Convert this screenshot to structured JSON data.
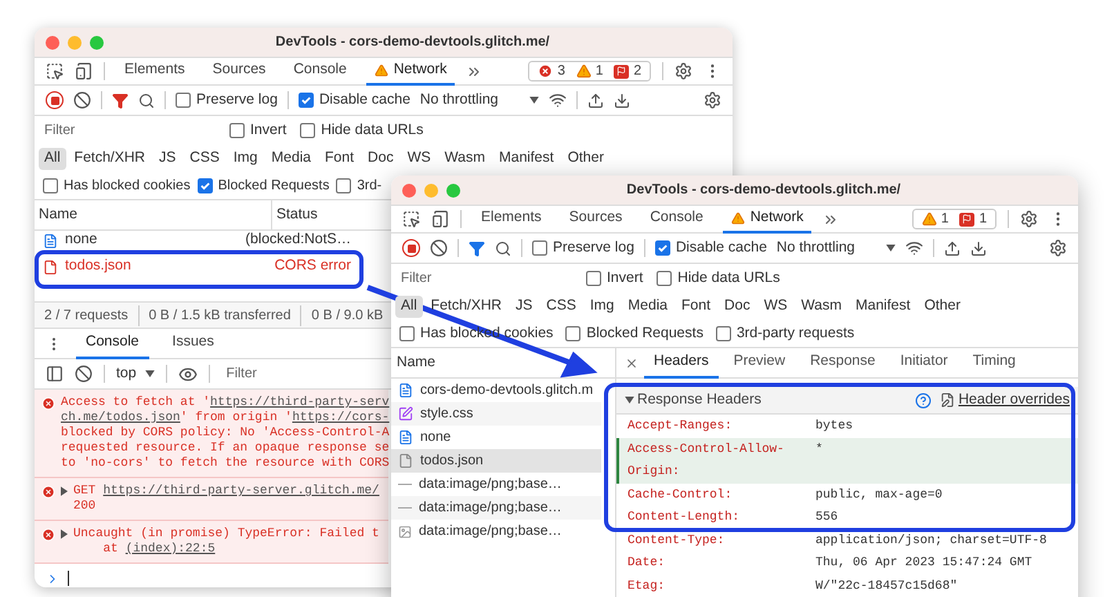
{
  "back_window": {
    "title": "DevTools - cors-demo-devtools.glitch.me/",
    "tabs": [
      {
        "label": "Elements",
        "selected": false,
        "warning": false
      },
      {
        "label": "Sources",
        "selected": false,
        "warning": false
      },
      {
        "label": "Console",
        "selected": false,
        "warning": false
      },
      {
        "label": "Network",
        "selected": true,
        "warning": true
      }
    ],
    "badges": [
      {
        "kind": "error",
        "count": "3"
      },
      {
        "kind": "warning",
        "count": "1"
      },
      {
        "kind": "issue",
        "count": "2"
      }
    ],
    "preserve_log": {
      "label": "Preserve log",
      "checked": false
    },
    "disable_cache": {
      "label": "Disable cache",
      "checked": true
    },
    "throttling": "No throttling",
    "filter": {
      "placeholder": "Filter"
    },
    "invert": {
      "label": "Invert",
      "checked": false
    },
    "hide_data_urls": {
      "label": "Hide data URLs",
      "checked": false
    },
    "type_filters": [
      {
        "label": "All",
        "selected": true
      },
      {
        "label": "Fetch/XHR",
        "selected": false
      },
      {
        "label": "JS",
        "selected": false
      },
      {
        "label": "CSS",
        "selected": false
      },
      {
        "label": "Img",
        "selected": false
      },
      {
        "label": "Media",
        "selected": false
      },
      {
        "label": "Font",
        "selected": false
      },
      {
        "label": "Doc",
        "selected": false
      },
      {
        "label": "WS",
        "selected": false
      },
      {
        "label": "Wasm",
        "selected": false
      },
      {
        "label": "Manifest",
        "selected": false
      },
      {
        "label": "Other",
        "selected": false
      }
    ],
    "extra_filters": [
      {
        "label": "Has blocked cookies",
        "checked": false
      },
      {
        "label": "Blocked Requests",
        "checked": true
      },
      {
        "label": "3rd-",
        "checked": false
      }
    ],
    "table": {
      "columns": [
        "Name",
        "Status"
      ],
      "rows": [
        {
          "name": "none",
          "status": "(blocked:NotS…",
          "error": false
        },
        {
          "name": "todos.json",
          "status": "CORS error",
          "error": true
        }
      ]
    },
    "status_bar": [
      "2 / 7 requests",
      "0 B / 1.5 kB transferred",
      "0 B / 9.0 kB"
    ],
    "drawer": {
      "tabs": [
        {
          "label": "Console",
          "selected": true
        },
        {
          "label": "Issues",
          "selected": false
        }
      ],
      "context": "top",
      "filter": {
        "placeholder": "Filter"
      },
      "messages": [
        {
          "kind": "error",
          "expandable": false,
          "lines": [
            [
              {
                "text": "Access to fetch at '",
                "link": false
              },
              {
                "text": "https://third-party-serv",
                "link": true
              }
            ],
            [
              {
                "text": "ch.me/todos.json",
                "link": true
              },
              {
                "text": "' from origin '",
                "link": false
              },
              {
                "text": "https://cors-",
                "link": true
              }
            ],
            [
              {
                "text": "blocked by CORS policy: No 'Access-Control-A",
                "link": false
              }
            ],
            [
              {
                "text": "requested resource. If an opaque response se",
                "link": false
              }
            ],
            [
              {
                "text": "to 'no-cors' to fetch the resource with CORS",
                "link": false
              }
            ]
          ]
        },
        {
          "kind": "error",
          "expandable": true,
          "lines": [
            [
              {
                "text": "GET ",
                "link": false
              },
              {
                "text": "https://third-party-server.glitch.me/",
                "link": true
              }
            ],
            [
              {
                "text": "200",
                "link": false
              }
            ]
          ]
        },
        {
          "kind": "error",
          "expandable": true,
          "lines": [
            [
              {
                "text": "Uncaught (in promise) TypeError: Failed t",
                "link": false
              }
            ],
            [
              {
                "text": "    at ",
                "link": false
              },
              {
                "text": "(index):22:5",
                "link": true
              }
            ]
          ]
        }
      ]
    }
  },
  "front_window": {
    "title": "DevTools - cors-demo-devtools.glitch.me/",
    "tabs": [
      {
        "label": "Elements",
        "selected": false,
        "warning": false
      },
      {
        "label": "Sources",
        "selected": false,
        "warning": false
      },
      {
        "label": "Console",
        "selected": false,
        "warning": false
      },
      {
        "label": "Network",
        "selected": true,
        "warning": true
      }
    ],
    "badges": [
      {
        "kind": "warning",
        "count": "1"
      },
      {
        "kind": "issue",
        "count": "1"
      }
    ],
    "preserve_log": {
      "label": "Preserve log",
      "checked": false
    },
    "disable_cache": {
      "label": "Disable cache",
      "checked": true
    },
    "throttling": "No throttling",
    "filter": {
      "placeholder": "Filter"
    },
    "invert": {
      "label": "Invert",
      "checked": false
    },
    "hide_data_urls": {
      "label": "Hide data URLs",
      "checked": false
    },
    "type_filters": [
      {
        "label": "All",
        "selected": true
      },
      {
        "label": "Fetch/XHR",
        "selected": false
      },
      {
        "label": "JS",
        "selected": false
      },
      {
        "label": "CSS",
        "selected": false
      },
      {
        "label": "Img",
        "selected": false
      },
      {
        "label": "Media",
        "selected": false
      },
      {
        "label": "Font",
        "selected": false
      },
      {
        "label": "Doc",
        "selected": false
      },
      {
        "label": "WS",
        "selected": false
      },
      {
        "label": "Wasm",
        "selected": false
      },
      {
        "label": "Manifest",
        "selected": false
      },
      {
        "label": "Other",
        "selected": false
      }
    ],
    "extra_filters": [
      {
        "label": "Has blocked cookies",
        "checked": false
      },
      {
        "label": "Blocked Requests",
        "checked": false
      },
      {
        "label": "3rd-party requests",
        "checked": false
      }
    ],
    "requests": {
      "column": "Name",
      "items": [
        {
          "name": "cors-demo-devtools.glitch.m",
          "kind": "document",
          "selected": false
        },
        {
          "name": "style.css",
          "kind": "stylesheet",
          "selected": false
        },
        {
          "name": "none",
          "kind": "document",
          "selected": false
        },
        {
          "name": "todos.json",
          "kind": "fetch",
          "selected": true
        },
        {
          "name": "data:image/png;base…",
          "kind": "data",
          "selected": false
        },
        {
          "name": "data:image/png;base…",
          "kind": "data",
          "selected": false
        },
        {
          "name": "data:image/png;base…",
          "kind": "image",
          "selected": false
        }
      ]
    },
    "detail_tabs": [
      {
        "label": "Headers",
        "selected": true
      },
      {
        "label": "Preview",
        "selected": false
      },
      {
        "label": "Response",
        "selected": false
      },
      {
        "label": "Initiator",
        "selected": false
      },
      {
        "label": "Timing",
        "selected": false
      }
    ],
    "section": {
      "title": "Response Headers",
      "expanded": true,
      "link": "Header overrides"
    },
    "headers": [
      {
        "name": "Accept-Ranges:",
        "value": "bytes",
        "highlighted": false
      },
      {
        "name": "Access-Control-Allow-Origin:",
        "value": "*",
        "highlighted": true
      },
      {
        "name": "Cache-Control:",
        "value": "public, max-age=0",
        "highlighted": false
      },
      {
        "name": "Content-Length:",
        "value": "556",
        "highlighted": false
      },
      {
        "name": "Content-Type:",
        "value": "application/json; charset=UTF-8",
        "highlighted": false
      },
      {
        "name": "Date:",
        "value": "Thu, 06 Apr 2023 15:47:24 GMT",
        "highlighted": false
      },
      {
        "name": "Etag:",
        "value": "W/\"22c-18457c15d68\"",
        "highlighted": false
      }
    ]
  }
}
